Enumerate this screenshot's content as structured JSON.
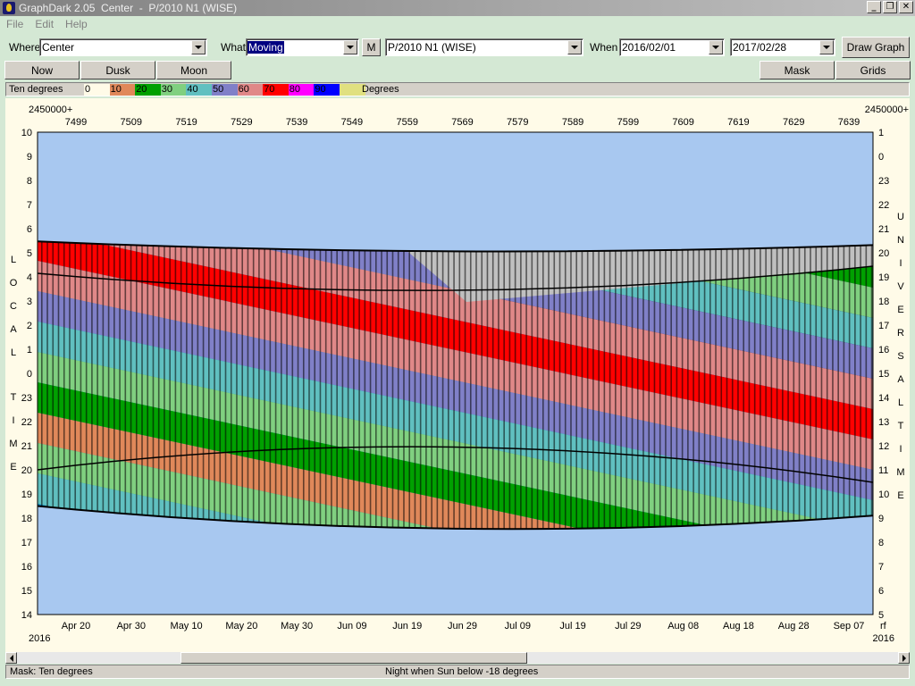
{
  "window": {
    "title": "GraphDark 2.05  Center  -  P/2010 N1 (WISE)"
  },
  "titlebar_buttons": [
    "_",
    "❐",
    "✕"
  ],
  "menu": [
    "File",
    "Edit",
    "Help"
  ],
  "toolbar": {
    "where_label": "Where",
    "where_value": "Center",
    "what_label": "What",
    "what_value": "Moving",
    "m_button": "M",
    "object_value": "P/2010 N1 (WISE)",
    "when_label": "When",
    "start_date": "2016/02/01",
    "end_date": "2017/02/28",
    "draw_button": "Draw Graph"
  },
  "buttons": {
    "now": "Now",
    "dusk": "Dusk",
    "moon": "Moon",
    "mask": "Mask",
    "grids": "Grids"
  },
  "legend": {
    "label": "Ten degrees",
    "unit": "Degrees",
    "swatches": [
      {
        "text": "0",
        "color": "#fffbe8"
      },
      {
        "text": "10",
        "color": "#e0885a"
      },
      {
        "text": "20",
        "color": "#00a000"
      },
      {
        "text": "30",
        "color": "#80d080"
      },
      {
        "text": "40",
        "color": "#60c0c0"
      },
      {
        "text": "50",
        "color": "#8080c8"
      },
      {
        "text": "60",
        "color": "#e08888"
      },
      {
        "text": "70",
        "color": "#ff0000"
      },
      {
        "text": "80",
        "color": "#ff00ff"
      },
      {
        "text": "90",
        "color": "#0000ff"
      },
      {
        "text": "",
        "color": "#e0e080"
      }
    ]
  },
  "chart_data": {
    "type": "heatmap",
    "jd_prefix": "2450000+",
    "year_left": "2016",
    "year_right": "2016",
    "jd_ticks": [
      "7499",
      "7509",
      "7519",
      "7529",
      "7539",
      "7549",
      "7559",
      "7569",
      "7579",
      "7589",
      "7599",
      "7609",
      "7619",
      "7629",
      "7639"
    ],
    "date_ticks": [
      "Apr 20",
      "Apr 30",
      "May 10",
      "May 20",
      "May 30",
      "Jun 09",
      "Jun 19",
      "Jun 29",
      "Jul 09",
      "Jul 19",
      "Jul 29",
      "Aug 08",
      "Aug 18",
      "Aug 28",
      "Sep 07"
    ],
    "left_axis_label": "LOCAL TIME",
    "left_ticks": [
      "10",
      "9",
      "8",
      "7",
      "6",
      "5",
      "4",
      "3",
      "2",
      "1",
      "0",
      "23",
      "22",
      "21",
      "20",
      "19",
      "18",
      "17",
      "16",
      "15",
      "14"
    ],
    "right_axis_label": "UNIVERSAL TIME",
    "right_ticks": [
      "1",
      "0",
      "23",
      "22",
      "21",
      "20",
      "19",
      "18",
      "17",
      "16",
      "15",
      "14",
      "13",
      "12",
      "11",
      "10",
      "9",
      "8",
      "7",
      "6",
      "5"
    ],
    "right_corner_label": "rf",
    "night_top_left": 5.5,
    "night_top_right": 5.7,
    "night_bottom_left": 18.5,
    "night_bottom_right": 18.1,
    "colors": {
      "sky": "#a8c8f0",
      "dark_sky": "#000040",
      "twilight": "#0080c0",
      "grey": "#c0c0c0"
    }
  },
  "status": {
    "mask": "Mask:  Ten degrees",
    "night": "Night when Sun below -18 degrees"
  }
}
